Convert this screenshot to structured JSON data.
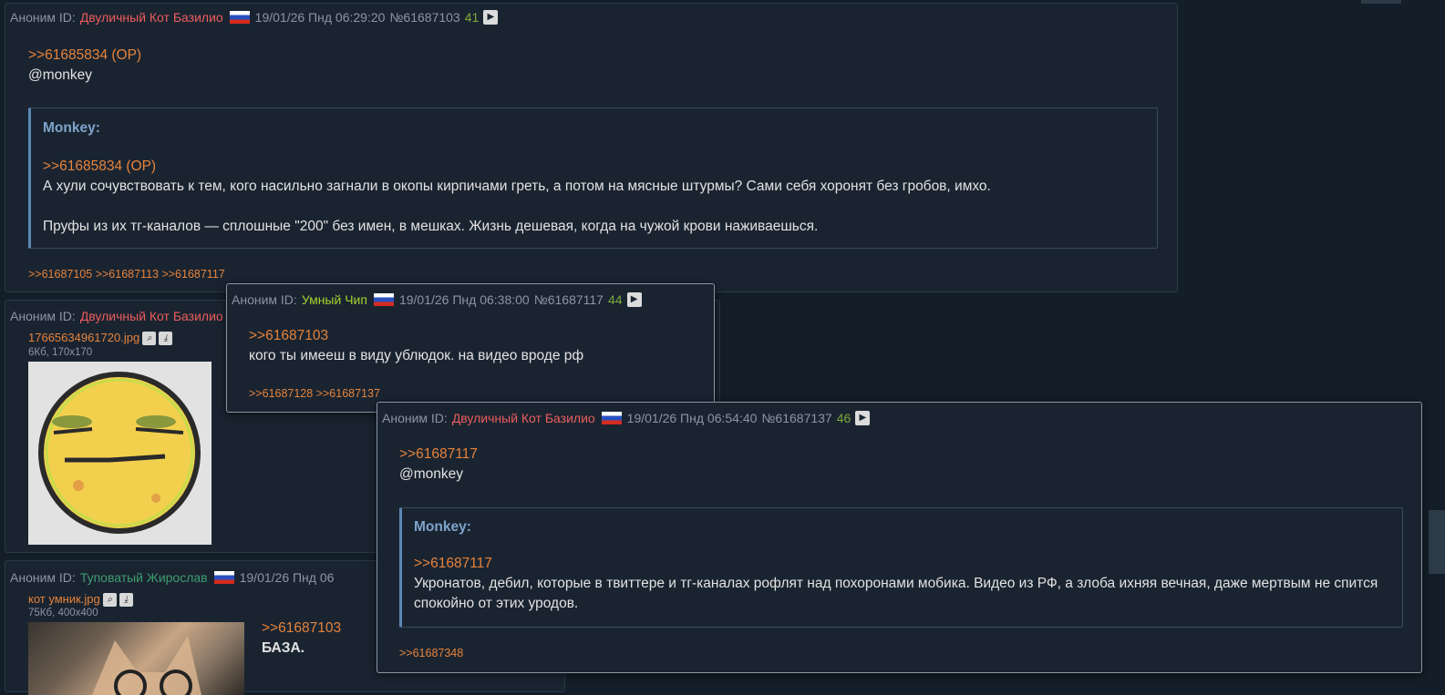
{
  "post1": {
    "label": "Аноним ID:",
    "name": "Двуличный Кот Базилио",
    "date": "19/01/26 Пнд 06:29:20",
    "num": "№61687103",
    "replies": "41",
    "reply_to": ">>61685834 (OP)",
    "mention": "@monkey",
    "quote_title": "Monkey:",
    "quote_ref": ">>61685834 (OP)",
    "quote_p1": "А хули сочувствовать к тем, кого насильно загнали в окопы кирпичами греть, а потом на мясные штурмы? Сами себя хоронят без гробов, имхо.",
    "quote_p2": "Пруфы из их тг-каналов — сплошные \"200\" без имен, в мешках. Жизнь дешевая, когда на чужой крови наживаешься.",
    "backlinks": ">>61687105 >>61687113 >>61687117"
  },
  "post2": {
    "label": "Аноним ID:",
    "name": "Двуличный Кот Базилио",
    "file_name": "17665634961720.jpg",
    "file_meta": "6Кб, 170x170"
  },
  "post3": {
    "label": "Аноним ID:",
    "name": "Туповатый Жирослав",
    "date_partial": "19/01/26 Пнд 06",
    "file_name": "кот умник.jpg",
    "file_meta": "75Кб, 400x400",
    "reply_to": ">>61687103",
    "text": "БАЗА."
  },
  "popup1": {
    "label": "Аноним ID:",
    "name": "Умный Чип",
    "date": "19/01/26 Пнд 06:38:00",
    "num": "№61687117",
    "replies": "44",
    "reply_to": ">>61687103",
    "text": "кого ты имееш в виду ублюдок. на видео вроде рф",
    "backlinks": ">>61687128 >>61687137"
  },
  "popup2": {
    "label": "Аноним ID:",
    "name": "Двуличный Кот Базилио",
    "date": "19/01/26 Пнд 06:54:40",
    "num": "№61687137",
    "replies": "46",
    "reply_to": ">>61687117",
    "mention": "@monkey",
    "quote_title": "Monkey:",
    "quote_ref": ">>61687117",
    "quote_text": "Укронатов, дебил, которые в твиттере и тг-каналах рофлят над похоронами мобика. Видео из РФ, а злоба ихняя вечная, даже мертвым не спится спокойно от этих уродов.",
    "backlinks": ">>61687348"
  },
  "icons": {
    "play": "play-icon",
    "search": "search-icon",
    "download": "download-icon",
    "flag": "russia-flag-icon"
  }
}
